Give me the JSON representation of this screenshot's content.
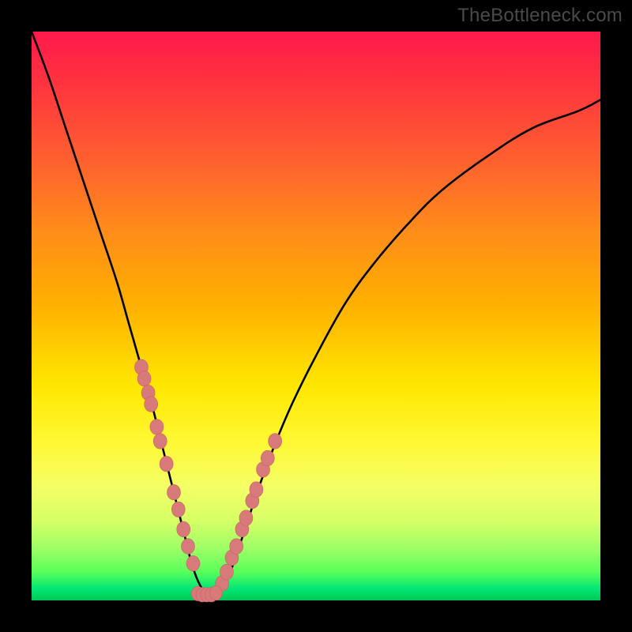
{
  "watermark": "TheBottleneck.com",
  "colors": {
    "curve": "#000000",
    "marker_fill": "#d87a7a",
    "marker_stroke": "#c96060"
  },
  "chart_data": {
    "type": "line",
    "title": "",
    "xlabel": "",
    "ylabel": "",
    "xlim": [
      0,
      100
    ],
    "ylim": [
      0,
      100
    ],
    "series": [
      {
        "name": "bottleneck-curve",
        "x": [
          0,
          3,
          6,
          9,
          12,
          15,
          17,
          19,
          21,
          23,
          24.5,
          26,
          27,
          28,
          29,
          30,
          31,
          32,
          33,
          34.5,
          36,
          38,
          40,
          43,
          46,
          50,
          55,
          60,
          66,
          72,
          80,
          88,
          96,
          100
        ],
        "y": [
          100,
          92,
          83,
          74,
          65,
          56,
          49,
          42,
          35,
          27,
          21,
          15,
          11,
          7,
          4,
          2,
          1,
          1,
          2,
          4,
          8,
          14,
          20,
          28,
          35,
          43,
          52,
          59,
          66,
          72,
          78,
          83,
          86,
          88
        ]
      }
    ],
    "markers_left": {
      "name": "left-branch-markers",
      "x": [
        19.3,
        19.8,
        20.5,
        21.0,
        22.0,
        22.6,
        23.7,
        25.0,
        25.8,
        26.7,
        27.5,
        28.4
      ],
      "y": [
        41.0,
        39.0,
        36.5,
        34.5,
        30.5,
        28.0,
        24.0,
        19.0,
        16.0,
        12.5,
        9.5,
        6.5
      ]
    },
    "markers_right": {
      "name": "right-branch-markers",
      "x": [
        33.5,
        34.3,
        35.2,
        36.0,
        37.0,
        37.7,
        38.8,
        39.5,
        40.7,
        41.5,
        42.8
      ],
      "y": [
        3.0,
        5.0,
        7.5,
        9.5,
        12.5,
        14.5,
        17.5,
        19.5,
        23.0,
        25.0,
        28.0
      ]
    },
    "markers_bottom": {
      "name": "trough-markers",
      "x": [
        29.2,
        30.0,
        30.8,
        31.6,
        32.4
      ],
      "y": [
        1.2,
        1.0,
        1.0,
        1.0,
        1.3
      ]
    }
  }
}
